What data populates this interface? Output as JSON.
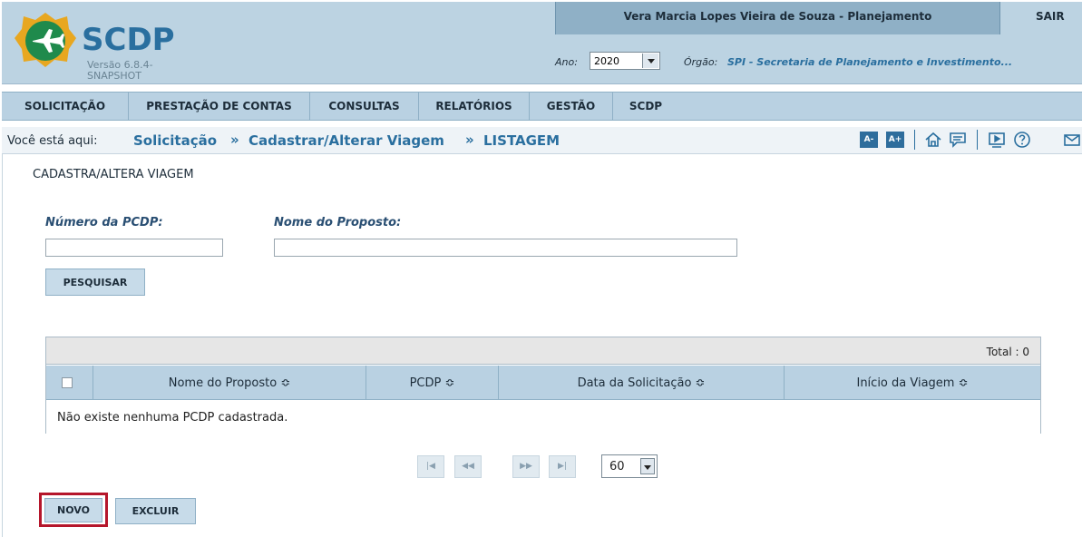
{
  "header": {
    "logo_title": "SCDP",
    "logo_version": "Versão 6.8.4-SNAPSHOT",
    "user_name": "Vera Marcia Lopes Vieira de Souza - Planejamento",
    "logout_label": "SAIR",
    "ano_label": "Ano:",
    "ano_value": "2020",
    "orgao_label": "Órgão:",
    "orgao_value": "SPI - Secretaria de Planejamento e Investimento..."
  },
  "nav": {
    "items": [
      {
        "label": "SOLICITAÇÃO"
      },
      {
        "label": "PRESTAÇÃO DE CONTAS"
      },
      {
        "label": "CONSULTAS"
      },
      {
        "label": "RELATÓRIOS"
      },
      {
        "label": "GESTÃO"
      },
      {
        "label": "SCDP"
      }
    ]
  },
  "breadcrumb": {
    "lead": "Você está aqui:",
    "items": [
      "Solicitação",
      "Cadastrar/Alterar Viagem",
      "LISTAGEM"
    ],
    "separator": "»"
  },
  "toolbar": {
    "font_decrease": "A-",
    "font_increase": "A+",
    "icons": [
      "home-icon",
      "chat-icon",
      "video-icon",
      "help-icon",
      "mail-icon"
    ]
  },
  "form": {
    "section_title": "CADASTRA/ALTERA VIAGEM",
    "pcdp_label": "Número da PCDP:",
    "pcdp_value": "",
    "proposto_label": "Nome do Proposto:",
    "proposto_value": "",
    "search_label": "PESQUISAR"
  },
  "table": {
    "total": "Total : 0",
    "columns": [
      "Nome do Proposto ≎",
      "PCDP ≎",
      "Data da Solicitação ≎",
      "Início da Viagem ≎"
    ],
    "empty_message": "Não existe nenhuma PCDP cadastrada."
  },
  "pager": {
    "first": "|◀",
    "prev": "◀◀",
    "next": "▶▶",
    "last": "▶|",
    "page_size": "60"
  },
  "actions": {
    "new_label": "NOVO",
    "delete_label": "EXCLUIR"
  },
  "colors": {
    "brand_blue": "#2a6f9f",
    "header_bg": "#bcd3e2",
    "highlight": "#b5162b"
  }
}
